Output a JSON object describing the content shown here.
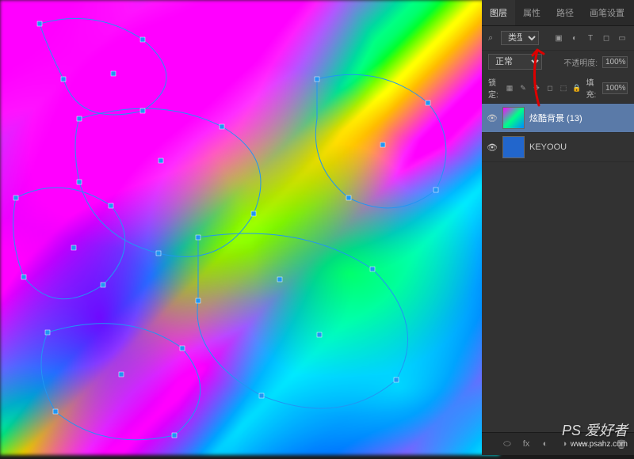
{
  "tabs": {
    "layers": "图层",
    "properties": "属性",
    "paths": "路径",
    "brush": "画笔设置"
  },
  "filter": {
    "type_label": "类型"
  },
  "blend": {
    "mode": "正常",
    "opacity_label": "不透明度:",
    "opacity_value": "100%"
  },
  "lock": {
    "label": "锁定:",
    "fill_label": "填充:",
    "fill_value": "100%"
  },
  "layers_list": [
    {
      "name": "炫酷背景 (13)",
      "selected": true,
      "solid": false
    },
    {
      "name": "KEYOOU",
      "selected": false,
      "solid": true
    }
  ],
  "watermark": {
    "main": "PS 爱好者",
    "url": "www.psahz.com"
  },
  "icons": {
    "search": "⌕",
    "image": "▣",
    "adjust": "◐",
    "text": "T",
    "shape": "◻",
    "smart": "▭",
    "lock_all": "▦",
    "lock_brush": "✎",
    "lock_move": "✥",
    "lock_crop": "◻",
    "lock_artboard": "⬚",
    "lock_icon": "🔒",
    "link": "⬭",
    "fx": "fx",
    "mask": "◐",
    "adjustment": "◑",
    "group": "▭",
    "new": "▫",
    "trash": "🗑",
    "eye": "👁"
  }
}
